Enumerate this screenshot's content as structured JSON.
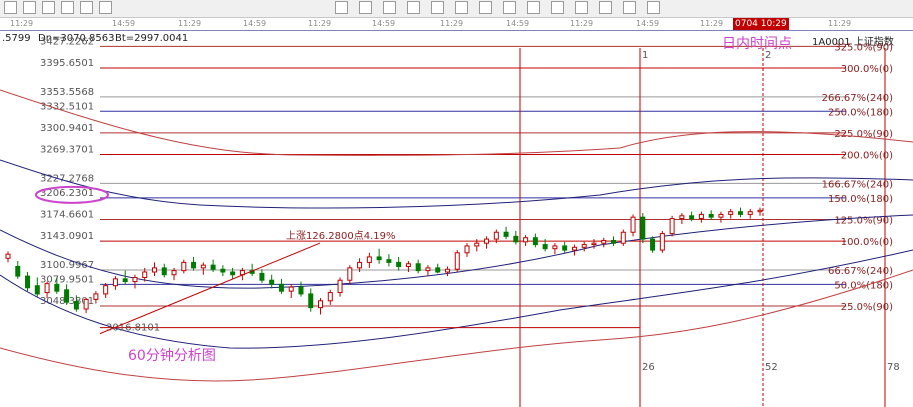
{
  "toolbar": {
    "icons": [
      "cursor-icon",
      "line-icon",
      "pen-icon",
      "grid-icon",
      "arrow-icon",
      "zoom-icon",
      "fib-icon",
      "text-icon",
      "circle-icon",
      "percent-icon",
      "trend-icon",
      "cross-icon",
      "gold-icon",
      "bar-icon",
      "wave-icon",
      "box-icon",
      "angle-icon",
      "channel-icon",
      "hand-icon",
      "mark-icon"
    ]
  },
  "time_axis": {
    "ticks": [
      {
        "label": "11:29",
        "x": 10
      },
      {
        "label": "14:59",
        "x": 112
      },
      {
        "label": "11:29",
        "x": 178
      },
      {
        "label": "14:59",
        "x": 243
      },
      {
        "label": "11:29",
        "x": 308
      },
      {
        "label": "14:59",
        "x": 372
      },
      {
        "label": "11:29",
        "x": 440
      },
      {
        "label": "14:59",
        "x": 506
      },
      {
        "label": "11:29",
        "x": 570
      },
      {
        "label": "14:59",
        "x": 636
      },
      {
        "label": "11:29",
        "x": 700
      },
      {
        "label": "11:29",
        "x": 828
      }
    ],
    "clock": "0704 10:29"
  },
  "info": {
    "left_value": ".5799",
    "dn": "Dn=3070.8563",
    "bt": "Bt=2997.0041",
    "index_name": "1A0001 上证指数"
  },
  "chart_data": {
    "type": "candlestick",
    "title": "",
    "annotation_period": "60分钟分析图",
    "annotation_time": "日内时间点",
    "annotation_rise": "上涨126.2800点4.19%",
    "low_label": "3016.8101",
    "ylim": [
      2990,
      3440
    ],
    "price_levels": [
      {
        "label": "3427.2262",
        "value": 3427.2262,
        "pct": "325.0%(90)",
        "style": "fib"
      },
      {
        "label": "3395.6501",
        "value": 3395.6501,
        "pct": "300.0%(0)",
        "style": "major"
      },
      {
        "label": "3353.5568",
        "value": 3353.5568,
        "pct": "266.67%(240)",
        "style": "minor"
      },
      {
        "label": "3332.5101",
        "value": 3332.5101,
        "pct": "250.0%(180)",
        "style": "blue"
      },
      {
        "label": "3300.9401",
        "value": 3300.9401,
        "pct": "225.0%(90)",
        "style": "fib"
      },
      {
        "label": "3269.3701",
        "value": 3269.3701,
        "pct": "200.0%(0)",
        "style": "major"
      },
      {
        "label": "3227.2768",
        "value": 3227.2768,
        "pct": "166.67%(240)",
        "style": "minor"
      },
      {
        "label": "3206.2301",
        "value": 3206.2301,
        "pct": "150.0%(180)",
        "style": "blue"
      },
      {
        "label": "3174.6601",
        "value": 3174.6601,
        "pct": "125.0%(90)",
        "style": "fib"
      },
      {
        "label": "3143.0901",
        "value": 3143.0901,
        "pct": "100.0%(0)",
        "style": "major"
      },
      {
        "label": "3100.9967",
        "value": 3100.9967,
        "pct": "66.67%(240)",
        "style": "minor"
      },
      {
        "label": "3079.9501",
        "value": 3079.9501,
        "pct": "50.0%(180)",
        "style": "blue"
      },
      {
        "label": "3048.3801",
        "value": 3048.3801,
        "pct": "25.0%(90)",
        "style": "fib"
      }
    ],
    "cycle_lines": [
      {
        "x": 520,
        "label": ""
      },
      {
        "x": 640,
        "label": "26"
      },
      {
        "x": 640,
        "label": "1",
        "top": true
      },
      {
        "x": 763,
        "label": "52",
        "dashed": true
      },
      {
        "x": 763,
        "label": "2",
        "top": true
      },
      {
        "x": 885,
        "label": "78"
      }
    ],
    "candles": [
      [
        3118,
        3128,
        3112,
        3124
      ],
      [
        3106,
        3114,
        3088,
        3092
      ],
      [
        3092,
        3098,
        3070,
        3075
      ],
      [
        3078,
        3090,
        3062,
        3066
      ],
      [
        3068,
        3084,
        3060,
        3081
      ],
      [
        3080,
        3090,
        3066,
        3070
      ],
      [
        3072,
        3080,
        3050,
        3054
      ],
      [
        3055,
        3064,
        3040,
        3044
      ],
      [
        3044,
        3060,
        3038,
        3058
      ],
      [
        3058,
        3070,
        3052,
        3066
      ],
      [
        3066,
        3082,
        3060,
        3078
      ],
      [
        3078,
        3092,
        3072,
        3088
      ],
      [
        3088,
        3100,
        3080,
        3084
      ],
      [
        3084,
        3094,
        3074,
        3090
      ],
      [
        3090,
        3104,
        3084,
        3098
      ],
      [
        3098,
        3112,
        3092,
        3104
      ],
      [
        3104,
        3110,
        3090,
        3094
      ],
      [
        3094,
        3104,
        3086,
        3100
      ],
      [
        3100,
        3116,
        3096,
        3112
      ],
      [
        3112,
        3120,
        3100,
        3104
      ],
      [
        3104,
        3112,
        3094,
        3108
      ],
      [
        3108,
        3116,
        3098,
        3102
      ],
      [
        3102,
        3108,
        3092,
        3098
      ],
      [
        3098,
        3104,
        3088,
        3094
      ],
      [
        3094,
        3104,
        3086,
        3100
      ],
      [
        3100,
        3110,
        3092,
        3096
      ],
      [
        3096,
        3102,
        3082,
        3086
      ],
      [
        3086,
        3094,
        3074,
        3080
      ],
      [
        3080,
        3088,
        3066,
        3070
      ],
      [
        3070,
        3080,
        3060,
        3076
      ],
      [
        3076,
        3084,
        3062,
        3066
      ],
      [
        3066,
        3074,
        3040,
        3046
      ],
      [
        3046,
        3060,
        3036,
        3056
      ],
      [
        3056,
        3072,
        3050,
        3068
      ],
      [
        3068,
        3090,
        3062,
        3086
      ],
      [
        3086,
        3108,
        3080,
        3104
      ],
      [
        3104,
        3118,
        3098,
        3112
      ],
      [
        3112,
        3126,
        3104,
        3120
      ],
      [
        3120,
        3132,
        3110,
        3116
      ],
      [
        3116,
        3124,
        3106,
        3112
      ],
      [
        3112,
        3120,
        3100,
        3106
      ],
      [
        3106,
        3114,
        3098,
        3110
      ],
      [
        3110,
        3116,
        3096,
        3100
      ],
      [
        3100,
        3108,
        3092,
        3104
      ],
      [
        3104,
        3110,
        3096,
        3098
      ],
      [
        3098,
        3106,
        3092,
        3102
      ],
      [
        3102,
        3130,
        3098,
        3126
      ],
      [
        3126,
        3140,
        3120,
        3136
      ],
      [
        3136,
        3146,
        3128,
        3140
      ],
      [
        3140,
        3150,
        3132,
        3146
      ],
      [
        3146,
        3160,
        3140,
        3156
      ],
      [
        3156,
        3164,
        3146,
        3150
      ],
      [
        3150,
        3158,
        3138,
        3142
      ],
      [
        3142,
        3152,
        3136,
        3148
      ],
      [
        3148,
        3154,
        3134,
        3138
      ],
      [
        3138,
        3146,
        3128,
        3132
      ],
      [
        3132,
        3140,
        3124,
        3136
      ],
      [
        3136,
        3142,
        3126,
        3130
      ],
      [
        3130,
        3138,
        3122,
        3134
      ],
      [
        3134,
        3142,
        3128,
        3138
      ],
      [
        3138,
        3146,
        3132,
        3140
      ],
      [
        3140,
        3148,
        3134,
        3144
      ],
      [
        3144,
        3150,
        3136,
        3140
      ],
      [
        3140,
        3160,
        3136,
        3156
      ],
      [
        3156,
        3182,
        3150,
        3178
      ],
      [
        3178,
        3184,
        3140,
        3146
      ],
      [
        3146,
        3150,
        3126,
        3130
      ],
      [
        3130,
        3158,
        3126,
        3154
      ],
      [
        3154,
        3180,
        3150,
        3176
      ],
      [
        3176,
        3184,
        3168,
        3180
      ],
      [
        3180,
        3186,
        3172,
        3176
      ],
      [
        3176,
        3186,
        3170,
        3182
      ],
      [
        3182,
        3188,
        3174,
        3178
      ],
      [
        3178,
        3186,
        3170,
        3182
      ],
      [
        3182,
        3190,
        3176,
        3186
      ],
      [
        3186,
        3192,
        3178,
        3182
      ],
      [
        3182,
        3190,
        3176,
        3186
      ],
      [
        3186,
        3192,
        3180,
        3188
      ]
    ]
  }
}
